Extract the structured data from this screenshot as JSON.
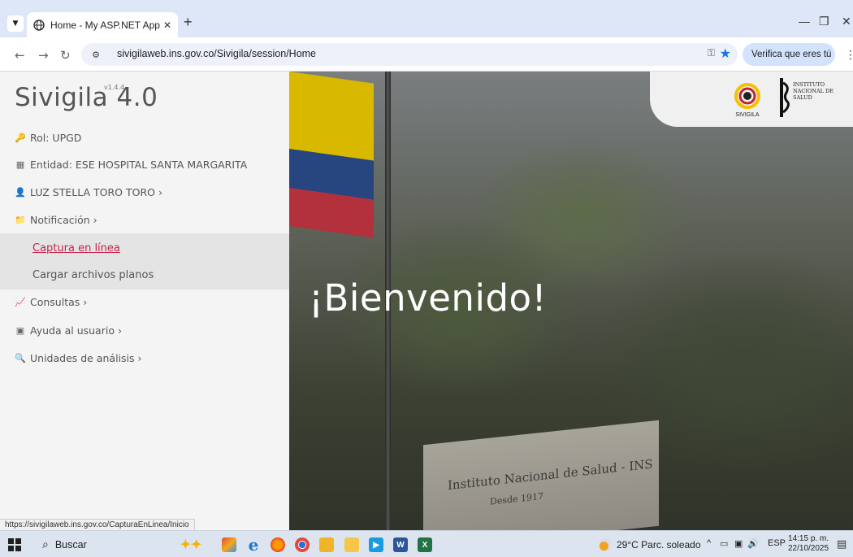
{
  "browser": {
    "tab_title": "Home - My ASP.NET Applicatio",
    "new_tab": "+",
    "url": "sivigilaweb.ins.gov.co/Sivigila/session/Home",
    "verify_label": "Verifica que eres tú",
    "status_url": "https://sivigilaweb.ins.gov.co/CapturaEnLinea/Inicio"
  },
  "sidebar": {
    "brand": "Sivigila 4.0",
    "version": "v1.4.4",
    "role": "Rol: UPGD",
    "entity": "Entidad: ESE HOSPITAL SANTA MARGARITA",
    "user": "LUZ STELLA TORO TORO ›",
    "notificacion": "Notificación ›",
    "sub_items": [
      "Captura en línea",
      "Cargar archivos planos"
    ],
    "consultas": "Consultas ›",
    "ayuda": "Ayuda al usuario ›",
    "unidades": "Unidades de análisis ›"
  },
  "hero": {
    "welcome": "¡Bienvenido!",
    "sign_line1": "Instituto Nacional de Salud - INS",
    "sign_line2": "Desde 1917",
    "sivigila_logo_text": "SIVIGILA",
    "ins_logo_text": [
      "INSTITUTO",
      "NACIONAL DE",
      "SALUD"
    ]
  },
  "taskbar": {
    "search": "Buscar",
    "weather": "29°C  Parc. soleado",
    "lang": "ESP",
    "time": "14:15 p. m.",
    "date": "22/10/2025"
  },
  "colors": {
    "active_link": "#c4244a",
    "sidebar_bg": "#f4f4f4",
    "accent": "#1a73e8"
  }
}
